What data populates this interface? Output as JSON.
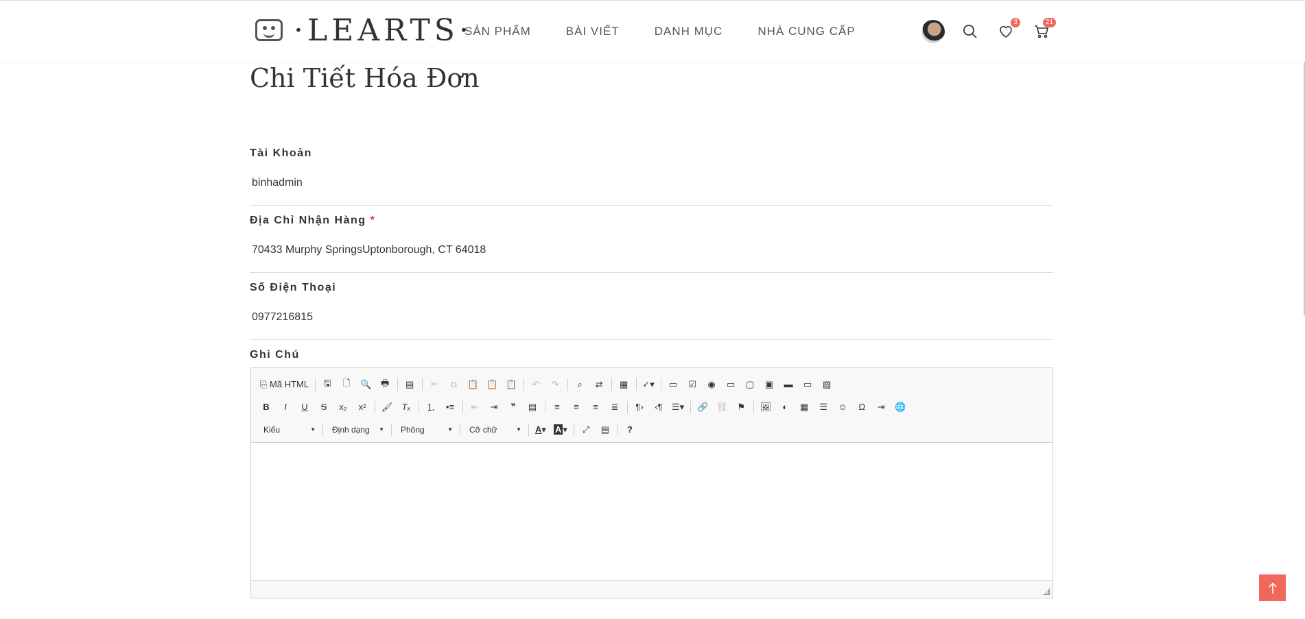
{
  "header": {
    "logo_text": "·LEARTS·",
    "nav": [
      "SẢN PHẨM",
      "BÀI VIẾT",
      "DANH MỤC",
      "NHÀ CUNG CẤP"
    ],
    "wishlist_count": "3",
    "cart_count": "21"
  },
  "page": {
    "title": "Chi Tiết Hóa Đơn"
  },
  "form": {
    "account_label": "Tài Khoản",
    "account_value": "binhadmin",
    "address_label": "Địa Chỉ Nhận Hàng",
    "address_required": "*",
    "address_value": "70433 Murphy SpringsUptonborough, CT 64018",
    "phone_label": "Số Điện Thoại",
    "phone_value": "0977216815",
    "note_label": "Ghi Chú"
  },
  "editor": {
    "source_label": "Mã HTML",
    "combo_style": "Kiểu",
    "combo_format": "Định dạng",
    "combo_font": "Phông",
    "combo_size": "Cỡ chữ",
    "help": "?"
  },
  "colors": {
    "accent": "#f0675c",
    "text": "#333333",
    "border": "#dddddd"
  }
}
